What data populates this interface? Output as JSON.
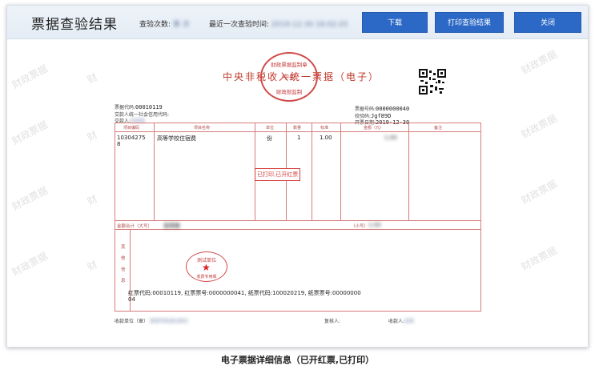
{
  "header": {
    "title": "票据查验结果",
    "query_count_label": "查验次数:",
    "query_count_value": "第 次",
    "last_check_label": "最近一次查验时间:",
    "last_check_value": "2019-12-30 16:02:25",
    "download_label": "下载",
    "print_result_label": "打印查验结果",
    "close_label": "关闭"
  },
  "watermark": {
    "text_main": "财政票据",
    "text_small": "财"
  },
  "invoice": {
    "title": "中央非税收入统一票据（电子）",
    "seal_top_lines": [
      "财政票据监制章",
      "中央",
      "财政部监制"
    ],
    "bill_code_label": "票据代码:",
    "bill_code_value": "00010119",
    "payer_code_label": "交款人统一社会信用代码:",
    "payer_label": "交款人:",
    "payer_value": "张某某",
    "bill_no_label": "票据号码:",
    "bill_no_value": "0000000040",
    "verify_code_label": "校验码:",
    "verify_code_value": "Jgf89D",
    "date_label": "开票日期:",
    "date_value": "2019-12-30",
    "columns": [
      "项目编码",
      "项目名称",
      "单位",
      "数量",
      "标准",
      "金额（元）",
      "备注"
    ],
    "row": {
      "code_line1": "10304275",
      "code_line2": "8",
      "name": "高等学校住宿费",
      "unit": "份",
      "qty": "1",
      "standard": "1.00",
      "amount": "1.00",
      "note": ""
    },
    "stamp_text": "已打印,已开红票",
    "total_label": "金额合计（大写）",
    "total_value": "壹圆整",
    "total_small_label": "（小写）",
    "total_small_value": "1.00",
    "other_info_label": [
      "其",
      "他",
      "信",
      "息"
    ],
    "red_line_1": "红票代码:00010119, 红票票号:0000000041, 纸票代码:100020219, 纸票票号:00000000",
    "red_line_2": "04",
    "seal_bottom_lines": [
      "测试单位",
      "收费专用章"
    ],
    "payee_label": "收款单位（章）",
    "payee_value": "某某学校测试单位",
    "reviewer_label": "复核人:",
    "collector_label": "收款人:",
    "collector_value": "张某"
  },
  "caption": "电子票据详细信息（已开红票,已打印）"
}
